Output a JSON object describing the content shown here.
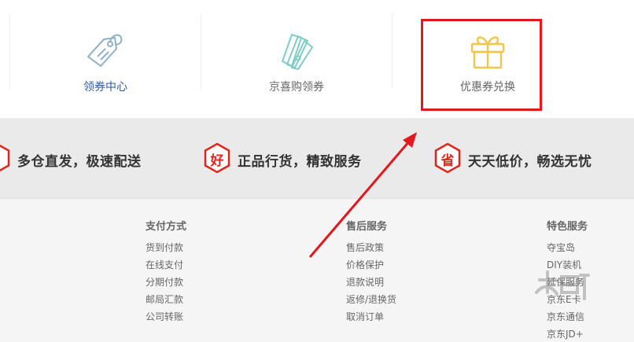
{
  "coupon_nav": {
    "items": [
      {
        "label": "领券中心",
        "icon": "tag-icon"
      },
      {
        "label": "京喜购领券",
        "icon": "tickets-icon"
      },
      {
        "label": "优惠券兑换",
        "icon": "gift-icon"
      }
    ]
  },
  "promises": [
    {
      "badge": "",
      "text": "多仓直发，极速配送"
    },
    {
      "badge": "好",
      "text": "正品行货，精致服务"
    },
    {
      "badge": "省",
      "text": "天天低价，畅选无忧"
    }
  ],
  "footer": {
    "columns": [
      {
        "title": "",
        "links": [
          "",
          "",
          "",
          "",
          ""
        ]
      },
      {
        "title": "支付方式",
        "links": [
          "货到付款",
          "在线支付",
          "分期付款",
          "邮局汇款",
          "公司转账"
        ]
      },
      {
        "title": "售后服务",
        "links": [
          "售后政策",
          "价格保护",
          "退款说明",
          "返修/退换货",
          "取消订单"
        ]
      },
      {
        "title": "特色服务",
        "links": [
          "夺宝岛",
          "DIY装机",
          "延保服务",
          "京东E卡",
          "京东通信",
          "京东JD+"
        ]
      }
    ]
  },
  "colors": {
    "accent_red": "#e1251b",
    "highlight_red": "#e4171b",
    "link_blue": "#2d5c9e"
  }
}
